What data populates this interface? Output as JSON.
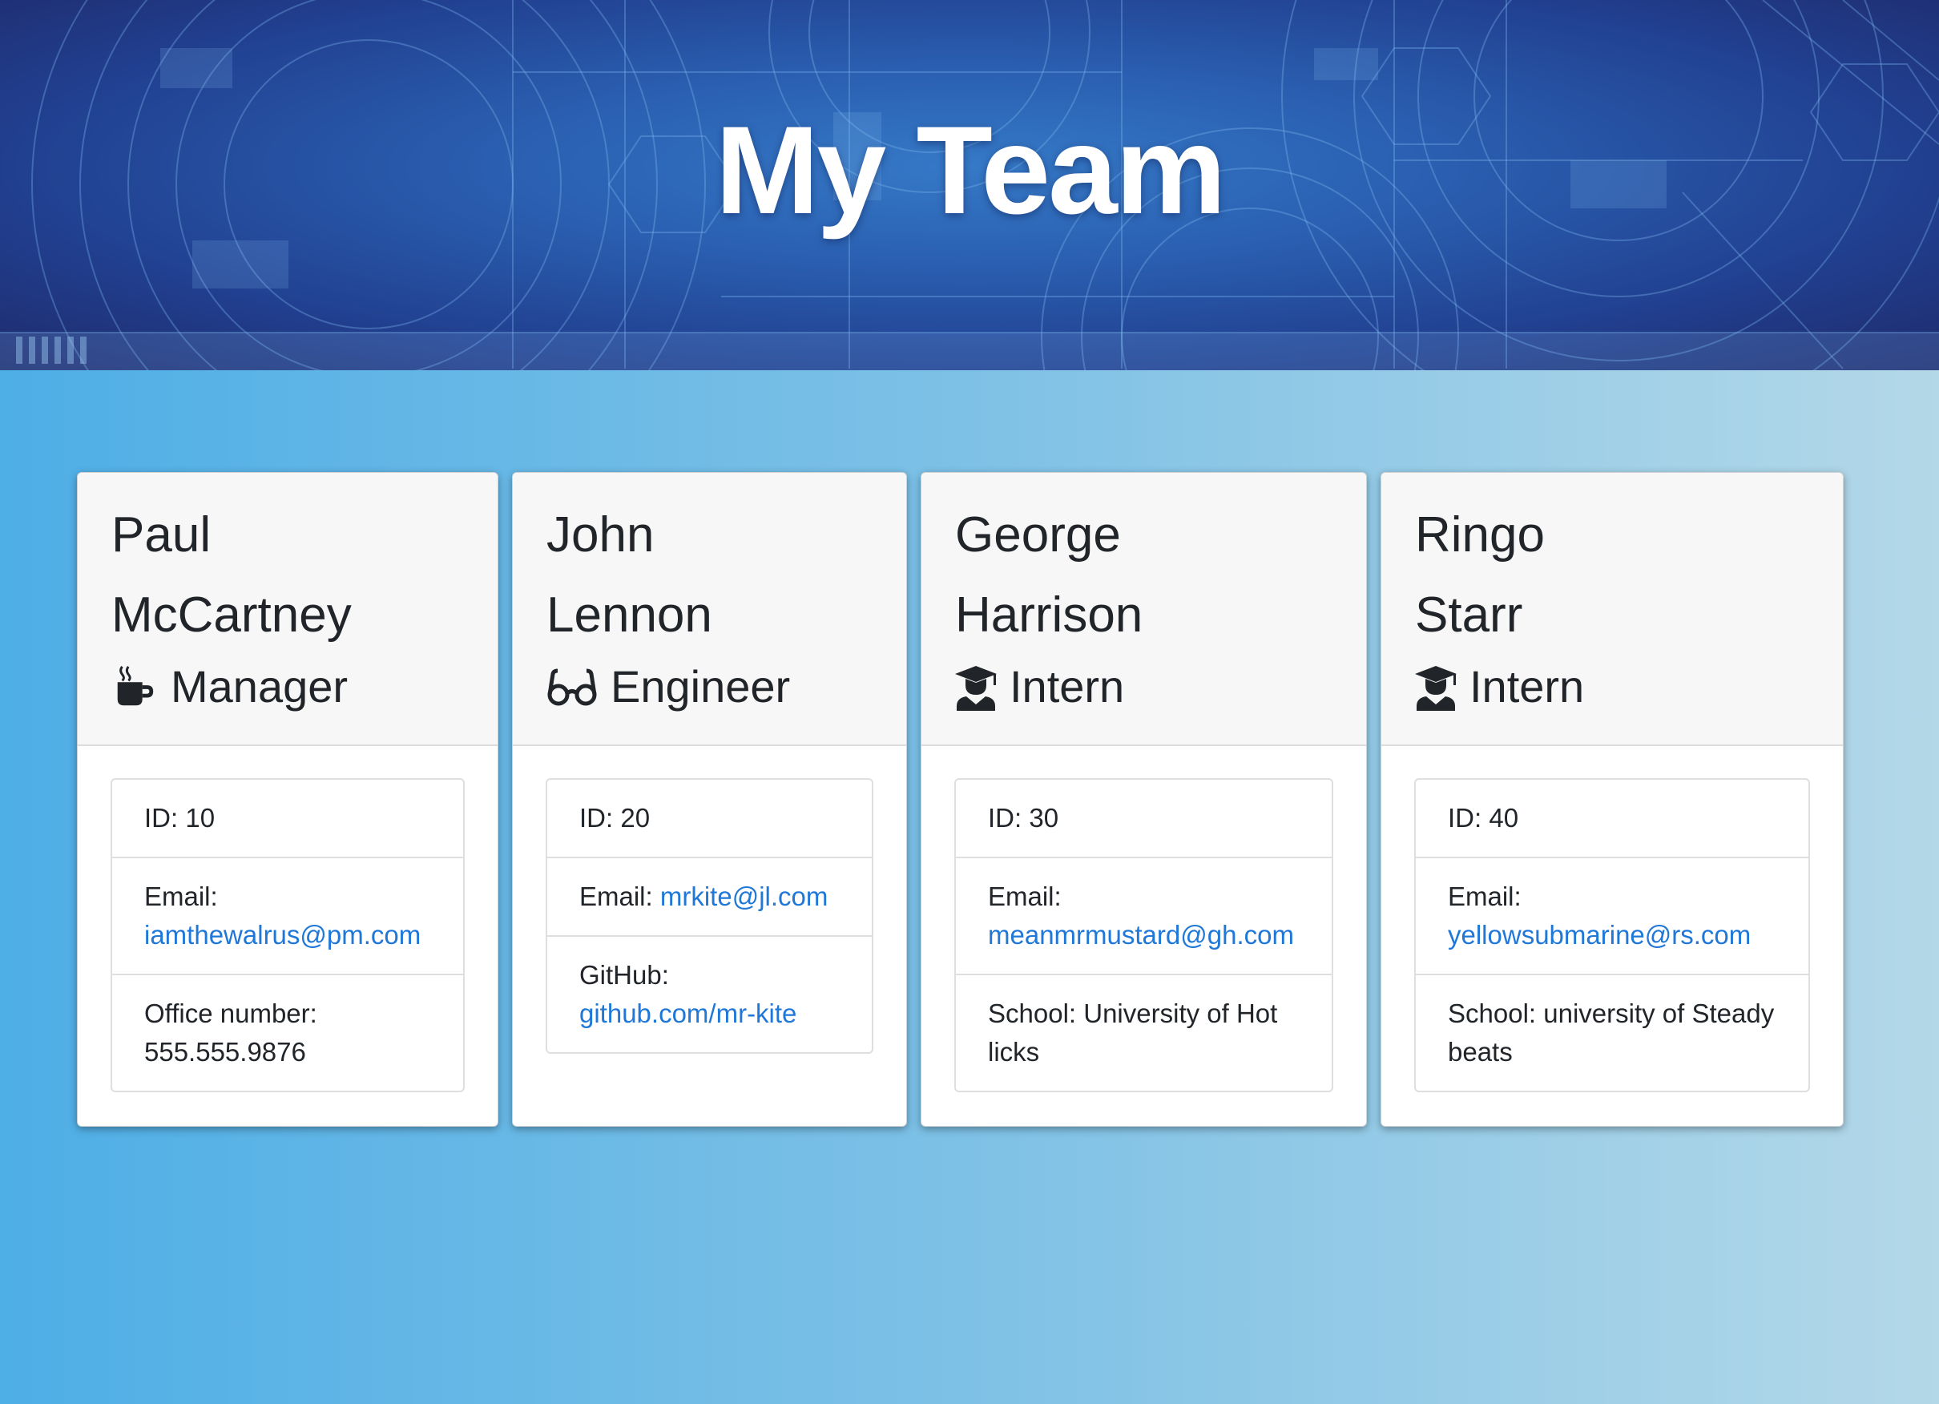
{
  "header": {
    "title": "My Team"
  },
  "colors": {
    "link": "#1f78d8",
    "card_header_bg": "#f7f7f7",
    "banner_dark": "#1e2a6b",
    "banner_light": "#3579c7"
  },
  "team": [
    {
      "first_name": "Paul",
      "last_name": "McCartney",
      "role": "Manager",
      "icon": "coffee-icon",
      "id_text": "ID: 10",
      "email_label": "Email:",
      "email": "iamthewalrus@pm.com",
      "extra_label": "Office number:",
      "extra_value": "555.555.9876"
    },
    {
      "first_name": "John",
      "last_name": "Lennon",
      "role": "Engineer",
      "icon": "glasses-icon",
      "id_text": "ID: 20",
      "email_label": "Email:",
      "email": "mrkite@jl.com",
      "extra_label": "GitHub:",
      "extra_value": "github.com/mr-kite"
    },
    {
      "first_name": "George",
      "last_name": "Harrison",
      "role": "Intern",
      "icon": "graduate-icon",
      "id_text": "ID: 30",
      "email_label": "Email:",
      "email": "meanmrmustard@gh.com",
      "extra_label": "School:",
      "extra_value": "University of Hot licks"
    },
    {
      "first_name": "Ringo",
      "last_name": "Starr",
      "role": "Intern",
      "icon": "graduate-icon",
      "id_text": "ID: 40",
      "email_label": "Email:",
      "email": "yellowsubmarine@rs.com",
      "extra_label": "School:",
      "extra_value": "university of Steady beats"
    }
  ]
}
